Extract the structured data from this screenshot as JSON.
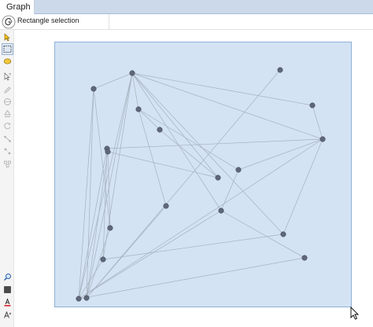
{
  "tab": {
    "label": "Graph"
  },
  "header": {
    "mode_label": "Rectangle selection"
  },
  "toolbar": {
    "tools": [
      {
        "name": "pointer-tool-icon",
        "selected": false
      },
      {
        "name": "rectangle-selection-tool-icon",
        "selected": true
      },
      {
        "name": "lasso-tool-icon",
        "selected": false
      },
      {
        "name": "drag-tool-icon",
        "selected": false
      },
      {
        "name": "pencil-tool-icon",
        "selected": false
      },
      {
        "name": "heat-tool-icon",
        "selected": false
      },
      {
        "name": "shortest-path-tool-icon",
        "selected": false
      },
      {
        "name": "size-tool-icon",
        "selected": false
      },
      {
        "name": "edge-pencil-tool-icon",
        "selected": false
      },
      {
        "name": "node-pencil-tool-icon",
        "selected": false
      },
      {
        "name": "painter-tool-icon",
        "selected": false
      }
    ],
    "bottom_tools": [
      "zoom-icon",
      "background-color-icon",
      "font-color-icon",
      "font-size-icon"
    ]
  },
  "colors": {
    "selection_fill": "#d3e3f4",
    "selection_border": "#8fb0d6",
    "node": "#5e6878",
    "edge": "#a6b1bd",
    "tab_strip": "#ccd9ea"
  }
}
